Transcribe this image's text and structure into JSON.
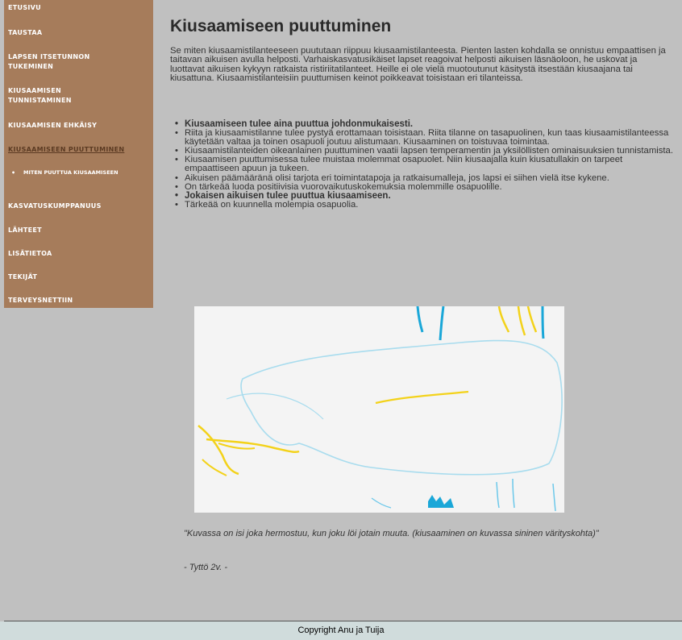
{
  "sidebar": {
    "items": [
      {
        "label": "ETUSIVU"
      },
      {
        "label": "TAUSTAA"
      },
      {
        "label": "LAPSEN ITSETUNNON TUKEMINEN"
      },
      {
        "label": "KIUSAAMISEN TUNNISTAMINEN"
      },
      {
        "label": "KIUSAAMISEN EHKÄISY"
      },
      {
        "label": "KIUSAAMISEEN PUUTTUMINEN"
      },
      {
        "label": "KASVATUSKUMPPANUUS"
      },
      {
        "label": "LÄHTEET"
      },
      {
        "label": "LISÄTIETOA"
      },
      {
        "label": "TEKIJÄT"
      },
      {
        "label": "TERVEYSNETTIIN"
      }
    ],
    "sub_item": {
      "label": "MITEN PUUTTUA KIUSAAMISEEN"
    },
    "active_color": "#5b3a22",
    "background": "#a67c5b"
  },
  "main": {
    "title": "Kiusaamiseen puuttuminen",
    "intro": "Se miten kiusaamistilanteeseen puututaan riippuu kiusaamistilanteesta. Pienten lasten kohdalla se onnistuu empaattisen ja taitavan aikuisen avulla helposti. Varhaiskasvatusikäiset lapset reagoivat helposti aikuisen läsnäoloon, he uskovat ja luottavat aikuisen kykyyn ratkaista ristiriitatilanteet. Heille ei ole vielä muotoutunut käsitystä itsestään kiusaajana tai kiusattuna. Kiusaamistilanteisiin puuttumisen keinot poikkeavat toisistaan eri tilanteissa.",
    "bullets": [
      {
        "text": "Kiusaamiseen tulee aina puuttua johdonmukaisesti.",
        "bold": true
      },
      {
        "text": "Riita ja kiusaamistilanne tulee pystyä erottamaan toisistaan. Riita tilanne on tasapuolinen, kun taas kiusaamistilanteessa käytetään valtaa ja toinen osapuoli joutuu alistumaan. Kiusaaminen on toistuvaa toimintaa.",
        "bold": false
      },
      {
        "text": "Kiusaamistilanteiden oikeanlainen puuttuminen vaatii lapsen temperamentin ja yksilöllisten ominaisuuksien tunnistamista.",
        "bold": false
      },
      {
        "text": "Kiusaamisen puuttumisessa tulee muistaa molemmat osapuolet. Niin kiusaajalla kuin kiusatullakin on tarpeet empaattiseen apuun ja tukeen.",
        "bold": false
      },
      {
        "text": "Aikuisen päämääränä olisi tarjota eri toimintatapoja ja ratkaisumalleja, jos lapsi ei siihen vielä itse kykene.",
        "bold": false
      },
      {
        "text": "On tärkeää luoda positiivisia vuorovaikutuskokemuksia molemmille osapuolille.",
        "bold": false
      },
      {
        "text": "Jokaisen aikuisen tulee puuttua kiusaamiseen.",
        "bold": true
      },
      {
        "text": "Tärkeää on kuunnella molempia osapuolia.",
        "bold": false
      }
    ],
    "caption": "\"Kuvassa on isi joka hermostuu, kun joku löi jotain muuta. (kiusaaminen on kuvassa sininen värityskohta)\"",
    "author": "- Tyttö 2v. -"
  },
  "footer": {
    "text": "Copyright Anu ja Tuija"
  }
}
